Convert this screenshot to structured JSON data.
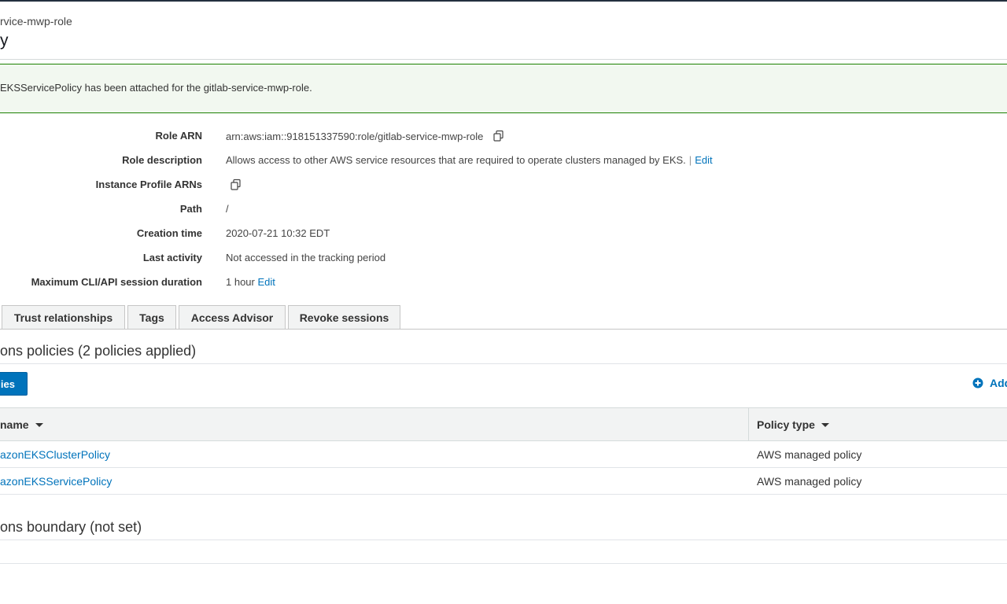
{
  "header": {
    "breadcrumb": "rvice-mwp-role",
    "title": "y"
  },
  "alert": {
    "message": "EKSServicePolicy has been attached for the gitlab-service-mwp-role."
  },
  "summary": {
    "role_arn_label": "Role ARN",
    "role_arn_value": "arn:aws:iam::918151337590:role/gitlab-service-mwp-role",
    "role_description_label": "Role description",
    "role_description_value": "Allows access to other AWS service resources that are required to operate clusters managed by EKS.",
    "role_description_sep": "|",
    "role_description_edit": "Edit",
    "instance_profile_label": "Instance Profile ARNs",
    "path_label": "Path",
    "path_value": "/",
    "creation_time_label": "Creation time",
    "creation_time_value": "2020-07-21 10:32 EDT",
    "last_activity_label": "Last activity",
    "last_activity_value": "Not accessed in the tracking period",
    "max_session_label": "Maximum CLI/API session duration",
    "max_session_value": "1 hour",
    "max_session_edit": "Edit"
  },
  "tabs": [
    {
      "label": "Trust relationships"
    },
    {
      "label": "Tags"
    },
    {
      "label": "Access Advisor"
    },
    {
      "label": "Revoke sessions"
    }
  ],
  "permissions": {
    "section_title": "ons policies (2 policies applied)",
    "attach_button": "ies",
    "add_inline": "Add",
    "columns": {
      "name": "name",
      "type": "Policy type"
    },
    "rows": [
      {
        "name": "azonEKSClusterPolicy",
        "type": "AWS managed policy"
      },
      {
        "name": "azonEKSServicePolicy",
        "type": "AWS managed policy"
      }
    ]
  },
  "boundary": {
    "section_title": "ons boundary (not set)"
  },
  "colors": {
    "link": "#0073bb",
    "primary_button": "#0073bb",
    "success_border": "#1d8102",
    "success_bg": "#f2f8f0"
  },
  "icons": {
    "copy": "copy-icon",
    "add": "plus-circle-icon",
    "sort": "caret-down-icon"
  }
}
